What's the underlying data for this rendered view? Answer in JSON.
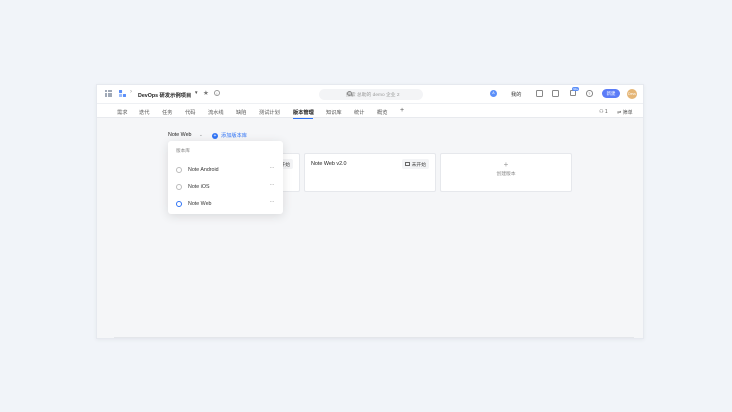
{
  "topbar": {
    "project_name": "DevOps 研发示例项目",
    "search_placeholder": "搜索 总助的 demo 企业 2",
    "ai_badge": "A",
    "mine_label": "我的",
    "msg_count": "99+",
    "new_button": "新建",
    "avatar_text": "Devs"
  },
  "tabs": [
    {
      "label": "需求"
    },
    {
      "label": "迭代"
    },
    {
      "label": "任务"
    },
    {
      "label": "代码"
    },
    {
      "label": "流水线"
    },
    {
      "label": "缺陷"
    },
    {
      "label": "测试计划"
    },
    {
      "label": "版本管理",
      "active": true
    },
    {
      "label": "知识库"
    },
    {
      "label": "统计"
    },
    {
      "label": "概览"
    }
  ],
  "tab_right": {
    "members_count": "1",
    "filter_label": "筛单"
  },
  "toolbar": {
    "selected_library": "Note Web",
    "add_library": "添加版本库"
  },
  "cards": [
    {
      "title": "Note Web v2.0",
      "status": "未开始"
    }
  ],
  "partial_card_status": "开始",
  "create_card": {
    "label": "创建版本"
  },
  "dropdown": {
    "header": "版本库",
    "items": [
      {
        "label": "Note Android",
        "selected": false
      },
      {
        "label": "Note iOS",
        "selected": false
      },
      {
        "label": "Note Web",
        "selected": true
      }
    ],
    "more_icon": "ellipsis-icon"
  },
  "colors": {
    "accent": "#2f73f5",
    "primary_button": "#5b7cf7"
  }
}
